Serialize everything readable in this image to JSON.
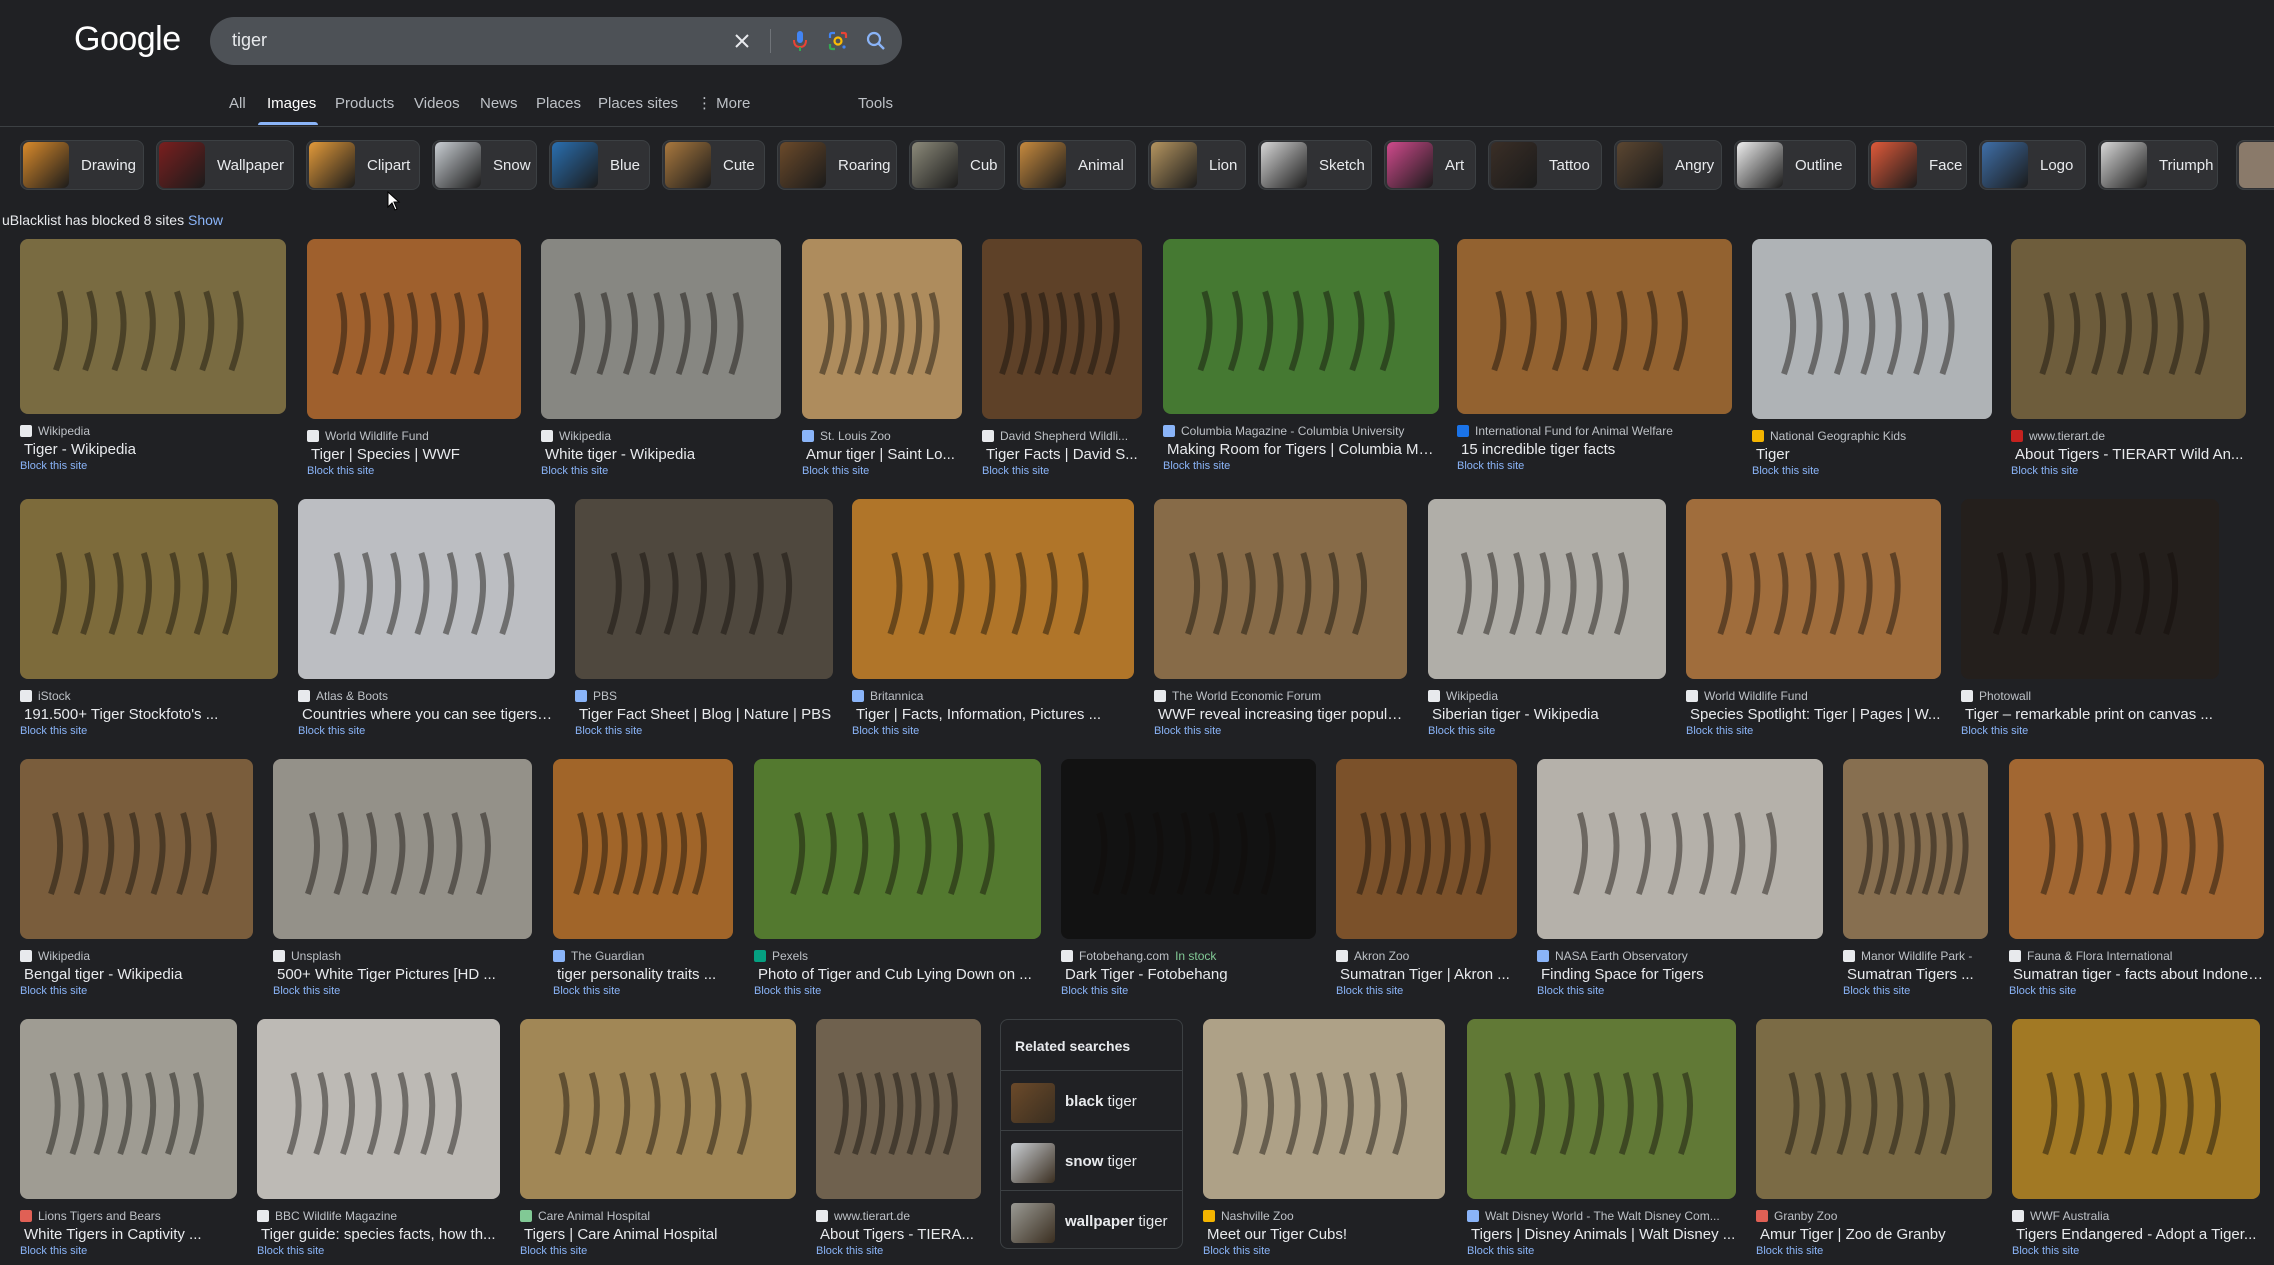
{
  "header": {
    "logo_text": "Google",
    "query": "tiger",
    "icons": {
      "clear": "close-icon",
      "voice": "microphone-icon",
      "lens": "google-lens-icon",
      "search": "search-icon"
    }
  },
  "tabs": [
    {
      "label": "All",
      "active": false
    },
    {
      "label": "Images",
      "active": true
    },
    {
      "label": "Products",
      "active": false
    },
    {
      "label": "Videos",
      "active": false
    },
    {
      "label": "News",
      "active": false
    },
    {
      "label": "Places",
      "active": false
    },
    {
      "label": "Places sites",
      "active": false
    },
    {
      "label": "More",
      "active": false,
      "icon": "more-vert-icon"
    },
    {
      "label": "Tools",
      "active": false
    }
  ],
  "chips": [
    {
      "label": "Drawing",
      "color": "#d98a2b"
    },
    {
      "label": "Wallpaper",
      "color": "#7a1f1f"
    },
    {
      "label": "Clipart",
      "color": "#e39a3a"
    },
    {
      "label": "Snow",
      "color": "#c9ced3"
    },
    {
      "label": "Blue",
      "color": "#2a6fb0"
    },
    {
      "label": "Cute",
      "color": "#a9783e"
    },
    {
      "label": "Roaring",
      "color": "#6b4a2a"
    },
    {
      "label": "Cub",
      "color": "#8c8a7a"
    },
    {
      "label": "Animal",
      "color": "#c78a3e"
    },
    {
      "label": "Lion",
      "color": "#b59560"
    },
    {
      "label": "Sketch",
      "color": "#d6d6d6"
    },
    {
      "label": "Art",
      "color": "#d04a8c"
    },
    {
      "label": "Tattoo",
      "color": "#3a2e26"
    },
    {
      "label": "Angry",
      "color": "#5b4631"
    },
    {
      "label": "Outline",
      "color": "#eeeeee"
    },
    {
      "label": "Face",
      "color": "#e05a3a"
    },
    {
      "label": "Logo",
      "color": "#3f6fa8"
    },
    {
      "label": "Triumph",
      "color": "#d8d8d8"
    }
  ],
  "blocked_notice": {
    "text": "uBlacklist has blocked 8 sites",
    "link": "Show"
  },
  "block_label": "Block this site",
  "results": [
    {
      "source": "Wikipedia",
      "title": "Tiger - Wikipedia",
      "img_color": "#8a7a4a",
      "fav_color": "#e8eaed"
    },
    {
      "source": "World Wildlife Fund",
      "title": "Tiger | Species | WWF",
      "img_color": "#b56e34",
      "fav_color": "#e8eaed"
    },
    {
      "source": "Wikipedia",
      "title": "White tiger - Wikipedia",
      "img_color": "#9a9a94",
      "fav_color": "#e8eaed"
    },
    {
      "source": "St. Louis Zoo",
      "title": "Amur tiger | Saint Lo...",
      "img_color": "#c7a06a",
      "fav_color": "#8ab4f8"
    },
    {
      "source": "David Shepherd Wildli...",
      "title": "Tiger Facts | David S...",
      "img_color": "#6b4a2e",
      "fav_color": "#e8eaed"
    },
    {
      "source": "Columbia Magazine - Columbia University",
      "title": "Making Room for Tigers | Columbia Ma...",
      "img_color": "#4f8a3a",
      "fav_color": "#8ab4f8"
    },
    {
      "source": "International Fund for Animal Welfare",
      "title": "15 incredible tiger facts",
      "img_color": "#a87037",
      "fav_color": "#1a73e8"
    },
    {
      "source": "National Geographic Kids",
      "title": "Tiger",
      "img_color": "#c8ccd0",
      "fav_color": "#f4b400"
    },
    {
      "source": "www.tierart.de",
      "title": "About Tigers - TIERART Wild An...",
      "img_color": "#7e6a45",
      "fav_color": "#c5221f"
    },
    {
      "source": "iStock",
      "title": "191.500+ Tiger Stockfoto's ...",
      "img_color": "#8f7a44",
      "fav_color": "#e8eaed"
    },
    {
      "source": "Atlas & Boots",
      "title": "Countries where you can see tigers i...",
      "img_color": "#d6d9dd",
      "fav_color": "#e8eaed"
    },
    {
      "source": "PBS",
      "title": "Tiger Fact Sheet | Blog | Nature | PBS",
      "img_color": "#5b5347",
      "fav_color": "#8ab4f8"
    },
    {
      "source": "Britannica",
      "title": "Tiger | Facts, Information, Pictures ...",
      "img_color": "#c9862f",
      "fav_color": "#8ab4f8"
    },
    {
      "source": "The World Economic Forum",
      "title": "WWF reveal increasing tiger popula...",
      "img_color": "#9a7a52",
      "fav_color": "#e8eaed"
    },
    {
      "source": "Wikipedia",
      "title": "Siberian tiger - Wikipedia",
      "img_color": "#c9c6c0",
      "fav_color": "#e8eaed"
    },
    {
      "source": "World Wildlife Fund",
      "title": "Species Spotlight: Tiger | Pages | W...",
      "img_color": "#b77d45",
      "fav_color": "#e8eaed"
    },
    {
      "source": "Photowall",
      "title": "Tiger – remarkable print on canvas ...",
      "img_color": "#2a2420",
      "fav_color": "#e8eaed"
    },
    {
      "source": "Wikipedia",
      "title": "Bengal tiger - Wikipedia",
      "img_color": "#8b6a45",
      "fav_color": "#e8eaed"
    },
    {
      "source": "Unsplash",
      "title": "500+ White Tiger Pictures [HD ...",
      "img_color": "#a9a59d",
      "fav_color": "#e8eaed"
    },
    {
      "source": "The Guardian",
      "title": "tiger personality traits ...",
      "img_color": "#b8742f",
      "fav_color": "#8ab4f8"
    },
    {
      "source": "Pexels",
      "title": "Photo of Tiger and Cub Lying Down on ...",
      "img_color": "#5f8a36",
      "fav_color": "#05a081"
    },
    {
      "source": "Fotobehang.com",
      "title": "Dark Tiger - Fotobehang",
      "img_color": "#151515",
      "fav_color": "#e8eaed",
      "stock": "In stock"
    },
    {
      "source": "Akron Zoo",
      "title": "Sumatran Tiger | Akron ...",
      "img_color": "#8c5d30",
      "fav_color": "#e8eaed"
    },
    {
      "source": "NASA Earth Observatory",
      "title": "Finding Space for Tigers",
      "img_color": "#cfcac2",
      "fav_color": "#8ab4f8"
    },
    {
      "source": "Manor Wildlife Park -",
      "title": "Sumatran Tigers ...",
      "img_color": "#9a7f5c",
      "fav_color": "#e8eaed"
    },
    {
      "source": "Fauna & Flora International",
      "title": "Sumatran tiger - facts about Indonesi...",
      "img_color": "#b9763a",
      "fav_color": "#e8eaed"
    },
    {
      "source": "Lions Tigers and Bears",
      "title": "White Tigers in Captivity ...",
      "img_color": "#b5b2a8",
      "fav_color": "#e06055"
    },
    {
      "source": "BBC Wildlife Magazine",
      "title": "Tiger guide: species facts, how th...",
      "img_color": "#d8d4cf",
      "fav_color": "#e8eaed"
    },
    {
      "source": "Care Animal Hospital",
      "title": "Tigers | Care Animal Hospital",
      "img_color": "#b89a62",
      "fav_color": "#81c995"
    },
    {
      "source": "www.tierart.de",
      "title": "About Tigers - TIERA...",
      "img_color": "#7f6f59",
      "fav_color": "#e8eaed"
    },
    {
      "source": "Nashville Zoo",
      "title": "Meet our Tiger Cubs!",
      "img_color": "#c7b89a",
      "fav_color": "#f4b400"
    },
    {
      "source": "Walt Disney World - The Walt Disney Com...",
      "title": "Tigers | Disney Animals | Walt Disney ...",
      "img_color": "#6f8a3e",
      "fav_color": "#8ab4f8"
    },
    {
      "source": "Granby Zoo",
      "title": "Amur Tiger | Zoo de Granby",
      "img_color": "#8d7a4f",
      "fav_color": "#e06055"
    },
    {
      "source": "WWF Australia",
      "title": "Tigers Endangered - Adopt a Tiger...",
      "img_color": "#b98a2a",
      "fav_color": "#e8eaed"
    }
  ],
  "related_searches": {
    "title": "Related searches",
    "items": [
      {
        "bold": "black",
        "rest": " tiger",
        "color": "#6b4a2a"
      },
      {
        "bold": "snow",
        "rest": " tiger",
        "color": "#c9ced3"
      },
      {
        "bold": "wallpaper",
        "rest": " tiger",
        "color": "#9a9a94"
      }
    ]
  }
}
